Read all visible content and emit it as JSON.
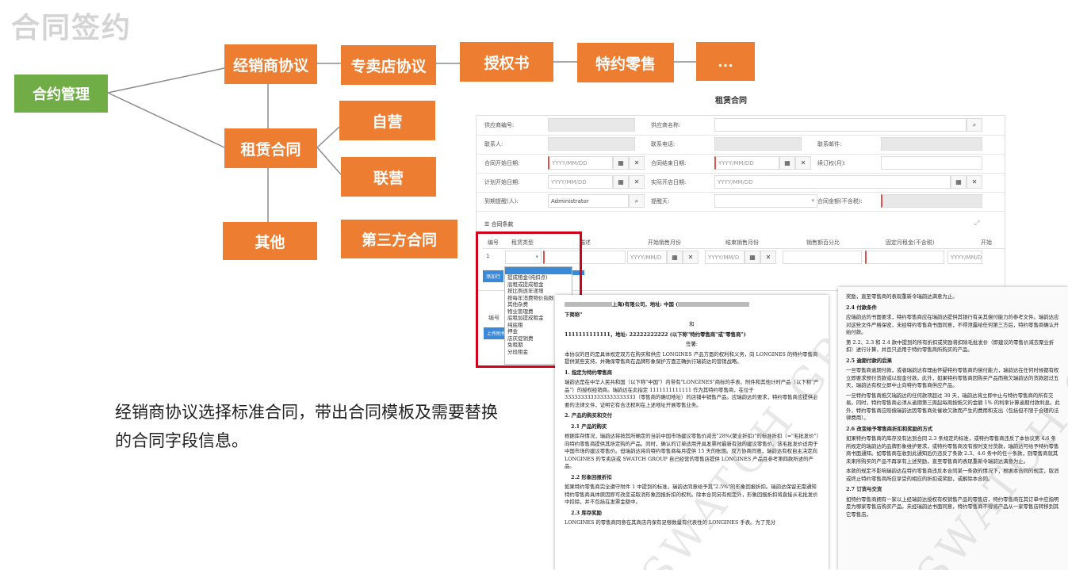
{
  "page_title": "合同签约",
  "mindmap": {
    "root": "合约管理",
    "level1": {
      "distributor": "经销商协议",
      "lease": "租赁合同",
      "other": "其他"
    },
    "distributor_chain": [
      "专卖店协议",
      "授权书",
      "特约零售",
      "..."
    ],
    "lease_children": [
      "自营",
      "联营"
    ],
    "third_party": "第三方合同"
  },
  "caption": "经销商协议选择标准合同，带出合同模板及需要替换的合同字段信息。",
  "doc_title": "租赁合同",
  "form": {
    "rows": [
      {
        "l1": "供应商编号:",
        "l2": "供应商名称:"
      },
      {
        "l1": "联系人:",
        "l2": "联系电话:",
        "l3": "联系邮件:"
      },
      {
        "l1": "合同开始日期:",
        "v1": "YYYY/MM/DD",
        "l2": "合同结束日期:",
        "v2": "YYYY/MM/DD",
        "l3": "续订权(月):"
      },
      {
        "l1": "计划开始日期:",
        "v1": "YYYY/MM/DD",
        "l2": "实际开店日期:",
        "v2": "YYYY/MM/DD"
      },
      {
        "l1": "到期提醒(人):",
        "v1": "Administrator",
        "l2": "提醒天:",
        "l3": "合同金额(不含税):"
      }
    ],
    "section_title": "合同条款",
    "columns": [
      "编号",
      "租赁类型",
      "描述",
      "开始销售月份",
      "结束销售月份",
      "销售额百分比",
      "固定月租金(不含税)",
      "开始"
    ],
    "row_no": "1",
    "date_placeholder": "YYYY/MM/D",
    "add_row": "添加行",
    "attachment": "附件",
    "attach_col": "编号",
    "upload": "上传附件",
    "lease_types": [
      "提成租金(纯扣点)",
      "底租或提成租金",
      "按比例逐年递增",
      "按每年消费物价指数",
      "其他杂费",
      "物业管理费",
      "底租加提成租金",
      "纯底租",
      "押金",
      "店庆促销费",
      "免租期",
      "分段租金"
    ]
  },
  "doc_page1": {
    "line1": "上海)有限公司，地址: 中国 (",
    "line2": "下简称\"",
    "and": "和",
    "line3": "1111111111111，地址: 22222222222 (以下称\"特约零售商\"或\"零售商\")",
    "sign": "签署:",
    "intro": "本协议的目的是具体规定双方在购买和供应 LONGINES 产品方面的权利和义务，向 LONGINES 的特约零售商提供某些支持，并确保零售商在品牌形象保护方面正确执行瑞韵达的营销战略。",
    "h1": "1. 指定为特约零售商",
    "p1": "瑞韵达是在中华人民共和国（以下称\"中国\"）内带有\"LONGINES\"商标的手表、附件和其他计时产品（以下称\"产品\"）的授权经销商。瑞韵达在此指定 1111111111111 作为其特约零售商，在位于 3333333333333333333333（零售商的确切地址）的店铺中销售产品。应瑞韵达的要求，特约零售商应提供必要的法律文件，证明它有合法权利在上述地址开展零售业务。",
    "h2": "2. 产品的购买和交付",
    "h21": "2.1 产品的购买",
    "p21": "根据库存情况，瑞韵达将按其所确定的当前中国市场建议零售价减去\"28%(聚业折扣)\"的标准折扣（=\"毛批发价\"）向特约零售商提供其所定购的产品。同时，确认的订单适用开具发票时最新有效的建议零售价。该毛批发价适用于中国市场的建议零售价。但瑞韵达将向特约零售商每月提供 15 天的账期。双方协商同意，瑞韵达有权自主决定向 LONGINES 的专卖店或 SWATCH GROUP 自己经营的零售店提供 LONGINES 产品且参考第四款所述的产品。",
    "h22": "2.2 形象回报折扣",
    "p22": "如果特约零售商完全遵守附件 1 中提到的标准，瑞韵达同意给予其\"2.5%\"的形象回报折扣。瑞韵达保留无需通知特约零售商具体原因即可改变或取消形象回报折扣的权利。除本合同另有规定外，形象回报折扣将直接从毛批发价中扣除，并不包括在发票金额中。",
    "h23": "2.3 库存奖励",
    "p23": "LONGINES 的零售商同意在其商店内保有足够数量有代表性的 LONGINES 手表。为了充分"
  },
  "doc_page2": {
    "p0": "奖励，直至零售商的表现重新令瑞韵达满意为止。",
    "h24": "2.4 付款条件",
    "p24a": "应瑞韵达的书面要求，特约零售商应在瑞韵达提供其银行有关其偿付能力的参考文件。瑞韵达应对这些文件严格保密，未经特约零售商书面同意，不得泄露给任何第三方后，特约零售商确认开始付款。",
    "p24b": "第 2.2、2.3 和 2.4 款中提到的所有折扣或奖励将扣除毛批发价（即建议的零售价减去聚业折扣）进行计算，并且只适用于特约零售商所购买的产品。",
    "h25": "2.5 逾期付款的后果",
    "p25a": "一旦零售商逾期付款，或者瑞韵达有理由怀疑特约零售商的偿付能力，瑞韵达在任何时候都有权立即要求预付货款或以现金付款。此外，如果特约零售商因购买产品而拖欠瑞韵达的货款超过五天，瑞韵达有权立即中止向特约零售商供应产品。",
    "p25b": "一旦特约零售商拖欠瑞韵达的任何款项超过 30 天，瑞韵达将立即中止与特约零售商的所有交易。同时，特约零售商必须从逾期第三周起每周按拖欠的金额 1% 的利率计算逾期付款利息。此外，特约零售商应赔偿瑞韵达因零售商处催收欠款而产生的费用和支出（包括但不限于合理的法律费用）。",
    "h26": "2.6 改变给予零售商折扣和奖励的方式",
    "p26a": "如果特约零售商的库存没有达到合同 2.3 条规定的标准，或特约零售商违反了本协议第 4.6 条所规定的瑞韵达的品牌形象维护要求，或特约零售商没有按时支付货款，瑞韵达可给予特约零售商书面通知。如零售商在收到此通知后仍违反了条款 2.3、4.6 条中的任一条款，则零售商就其未来所购买的产品不再享有上述奖励，直至零售商的表现重新令瑞韵达满意为止。",
    "p26b": "本款的规定不影响瑞韵达在特约零售商违反本合同某一条款的情况下，根据本合同的规定，取消或终止特约零售商所应享受的相应的折扣或奖励，或解除本合同。",
    "h27": "2.7 订货与交货",
    "p27": "如特约零售商拥有一家以上经瑞韵达授权有权销售产品的零售店，特约零售商在其订单中应指明是为哪家零售店购买产品。未经瑞韵达书面同意，特约零售商不得将产品从一家零售店转移到其它零售店。"
  },
  "watermark": "SWATCH GROUP"
}
